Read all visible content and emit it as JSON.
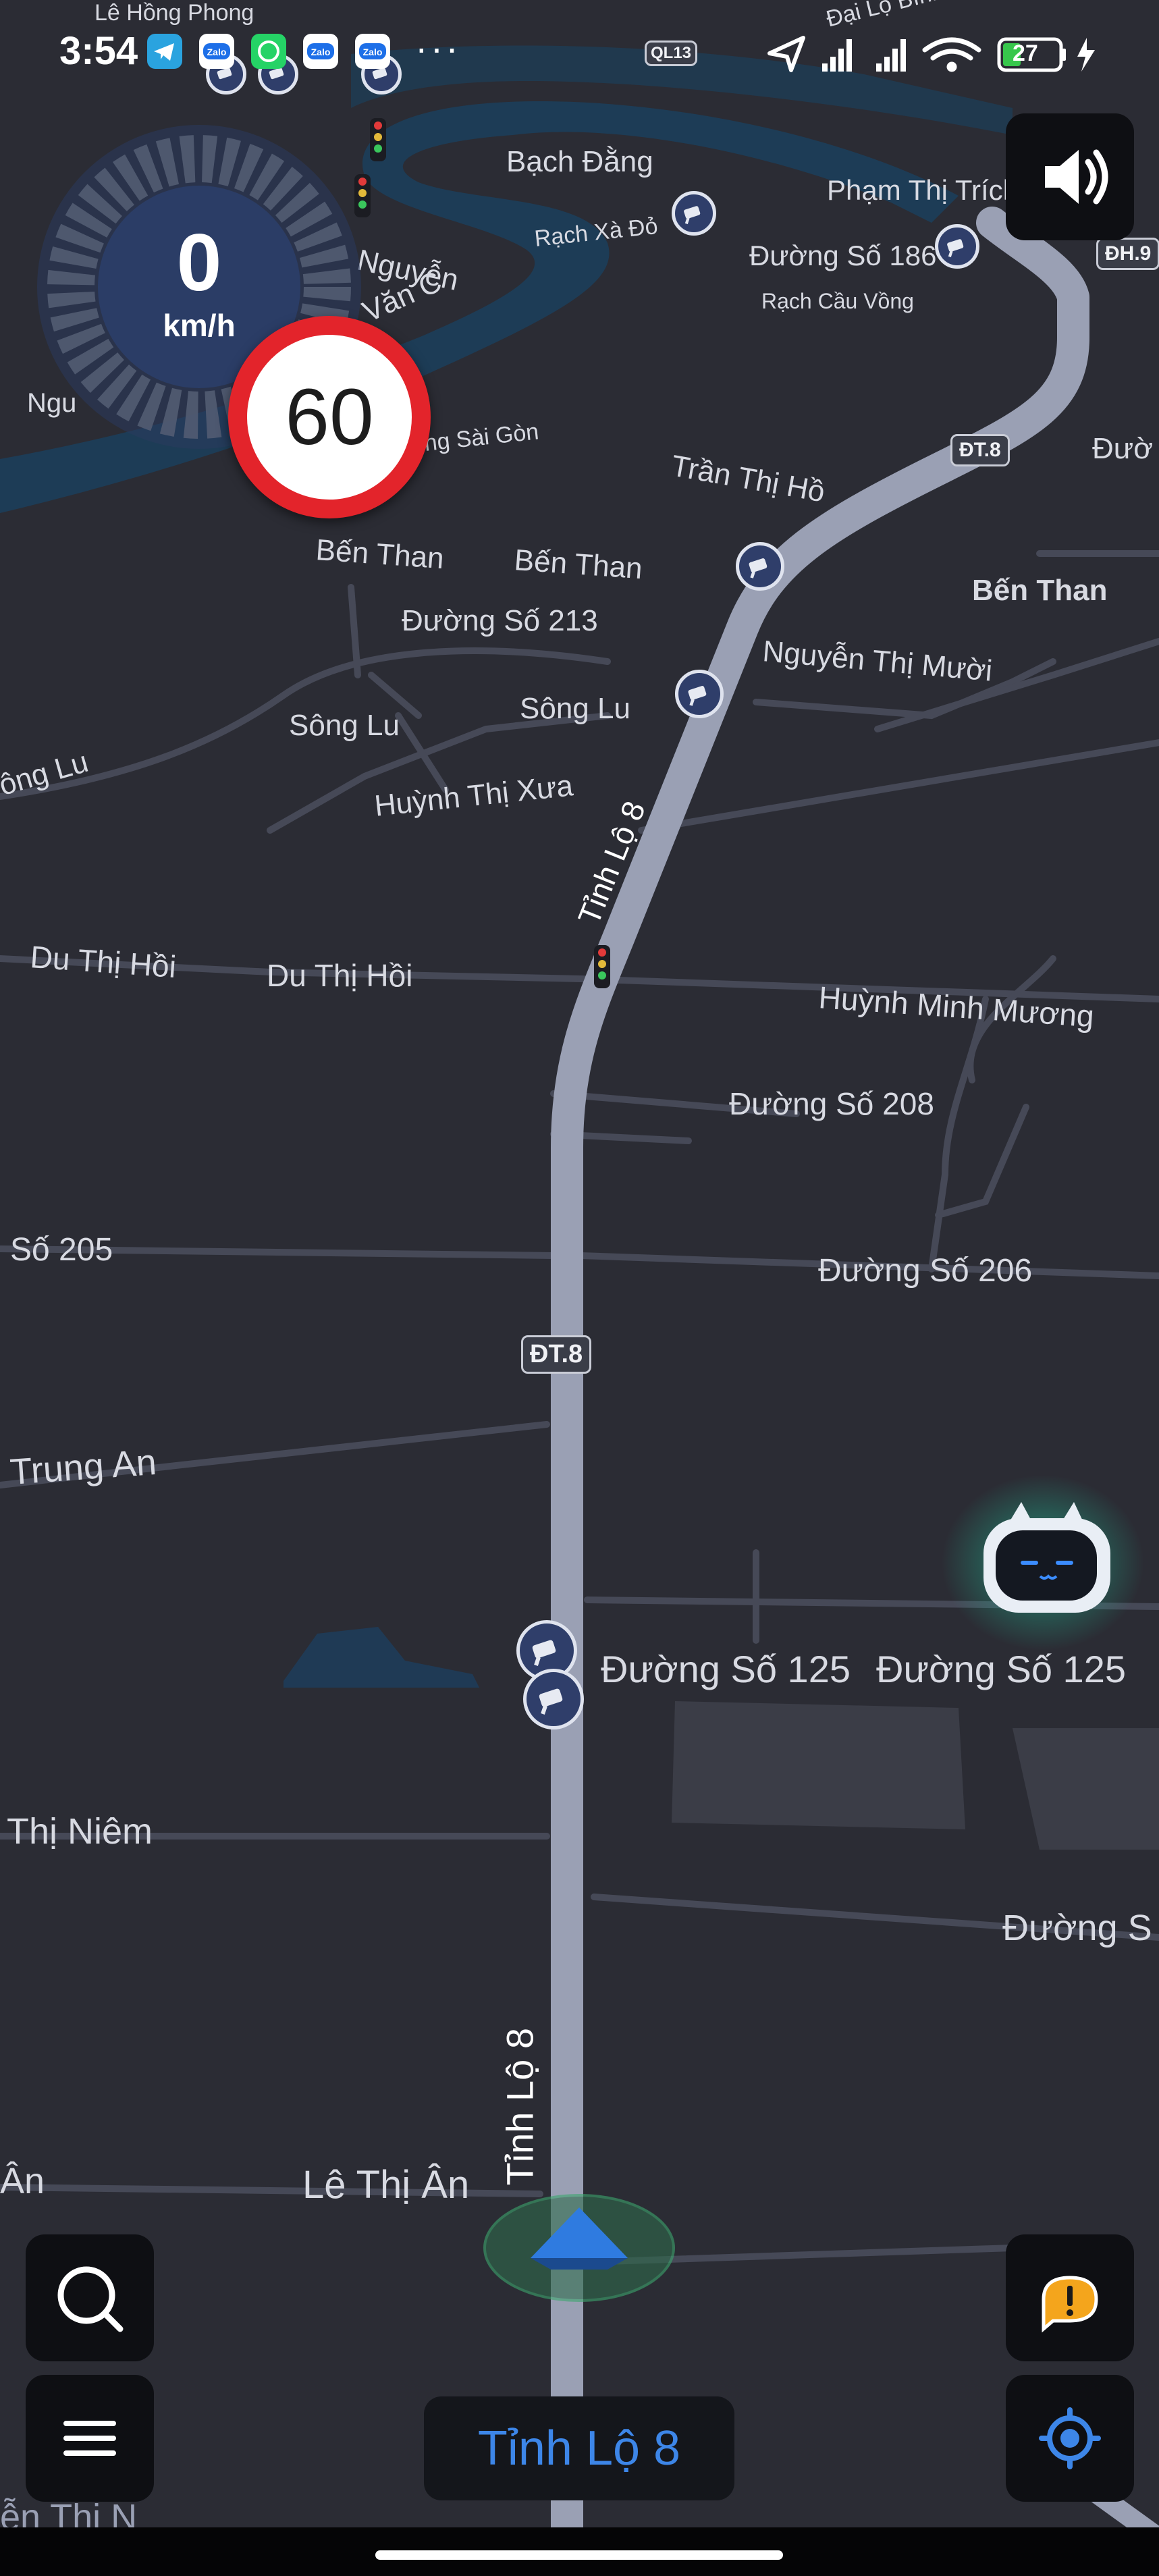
{
  "status_bar": {
    "time": "3:54",
    "app_icons": [
      "telegram-icon",
      "zalo-icon",
      "whatsapp-icon",
      "zalo-icon",
      "zalo-icon"
    ],
    "more": "···",
    "road_badge": "QL13",
    "battery": "27",
    "icons": [
      "location-arrow-icon",
      "signal-icon",
      "signal-icon",
      "wifi-icon",
      "battery-icon",
      "charging-icon"
    ]
  },
  "speedometer": {
    "speed": "0",
    "unit": "km/h",
    "speed_limit": "60"
  },
  "map": {
    "labels": {
      "le_hong_phong": "Lê Hồng Phong",
      "dai_lo_binh_duong": "Đại Lộ Bình D",
      "bach_dang": "Bạch Đằng",
      "pham_thi_trich": "Phạm Thị Trích",
      "rach_xa_do": "Rạch Xà Đỏ",
      "duong_so_186": "Đường Số 186",
      "rach_cau_vong": "Rạch Cầu Vồng",
      "nguyen_partial_top": "Nguyễn",
      "van_partial": "Văn C",
      "ngu_partial": "Ngu",
      "song_sai_gon": "ông Sài Gòn",
      "tran_thi_ho": "Trần Thị Hồ",
      "duong_right_partial": "Đườ",
      "ben_than_1": "Bến Than",
      "ben_than_2": "Bến Than",
      "ben_than_3": "Bến Than",
      "duong_so_213": "Đường Số 213",
      "nguyen_thi_muoi": "Nguyễn Thị Mười",
      "song_lu_1": "Sông Lu",
      "song_lu_2": "Sông Lu",
      "song_lu_3": "ông Lu",
      "huynh_thi_xua": "Huỳnh Thị Xưa",
      "tinh_lo_8_upper": "Tỉnh Lộ 8",
      "du_thi_hoi_1": "Du Thị Hồi",
      "du_thi_hoi_2": "Du Thị Hồi",
      "huynh_minh_muong": "Huỳnh Minh Mương",
      "duong_so_208": "Đường Số 208",
      "so_205": "Số 205",
      "duong_so_206": "Đường Số 206",
      "trung_an": "Trung An",
      "duong_so_125_1": "Đường Số 125",
      "duong_so_125_2": "Đường Số 125",
      "thi_niem": "Thị Niêm",
      "duong_s_partial": "Đường S",
      "tinh_lo_8_lower": "Tỉnh Lộ 8",
      "le_thi_an": "Lê Thị Ân",
      "an_partial": "Ân",
      "bottom_partial": "ễn Thị N"
    },
    "shields": {
      "dh9": "ĐH.9",
      "dt8_upper": "ĐT.8",
      "dt8_lower": "ĐT.8"
    }
  },
  "buttons": {
    "sound": "speaker-icon",
    "search": "search-icon",
    "menu": "menu-icon",
    "report": "report-icon",
    "locate": "locate-icon"
  },
  "current_street": "Tỉnh Lộ 8",
  "colors": {
    "accent": "#3d86e8",
    "limit_ring": "#e3242b",
    "route": "#9aa0b4",
    "background": "#2b2c34"
  }
}
